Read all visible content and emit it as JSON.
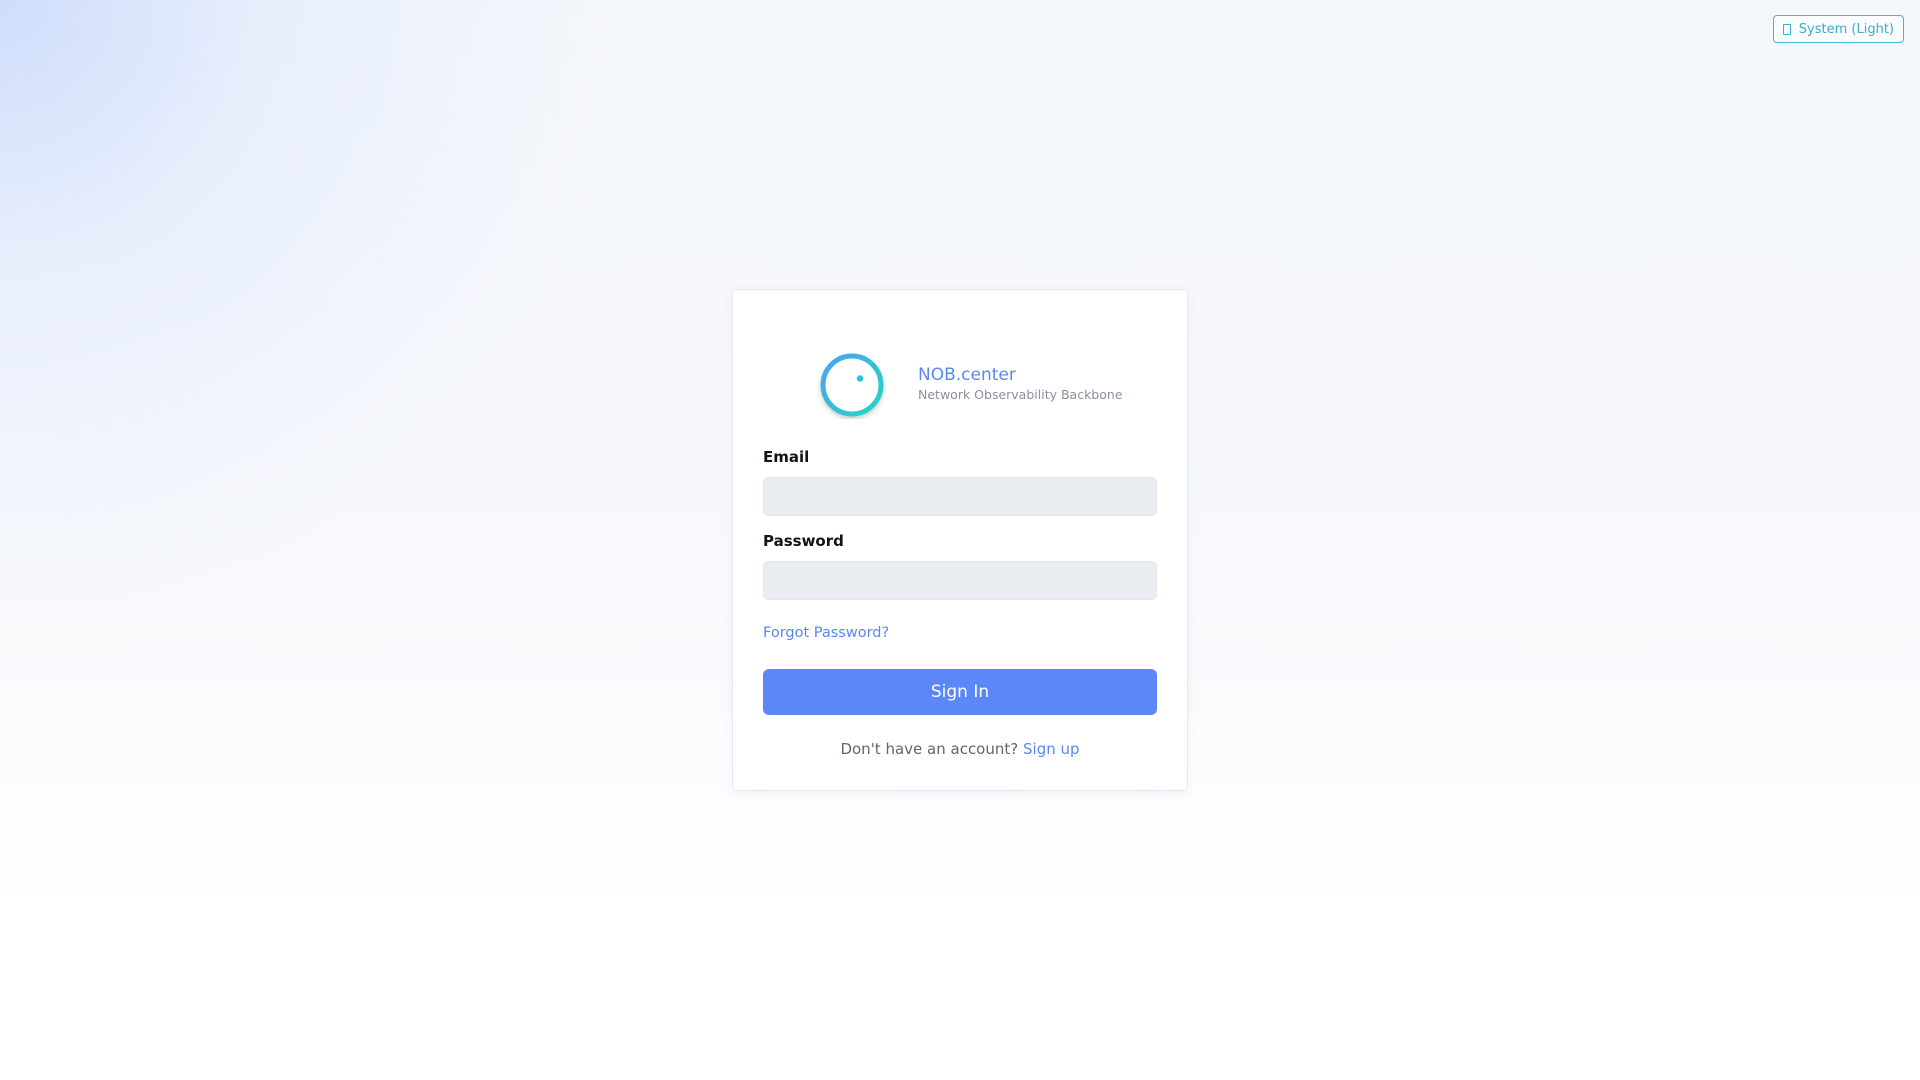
{
  "theme_toggle": {
    "icon": "device-icon",
    "label": "System (Light)"
  },
  "brand": {
    "name": "NOB.center",
    "tagline": "Network Observability Backbone"
  },
  "form": {
    "email_label": "Email",
    "email_value": "",
    "password_label": "Password",
    "password_value": "",
    "forgot_link": "Forgot Password?",
    "submit_label": "Sign In",
    "signup_prompt": "Don't have an account?",
    "signup_link": "Sign up"
  },
  "colors": {
    "accent": "#5b87f8",
    "logo_gradient_start": "#4aa8f0",
    "logo_gradient_end": "#2dd4c4",
    "toggle": "#35aecf"
  }
}
